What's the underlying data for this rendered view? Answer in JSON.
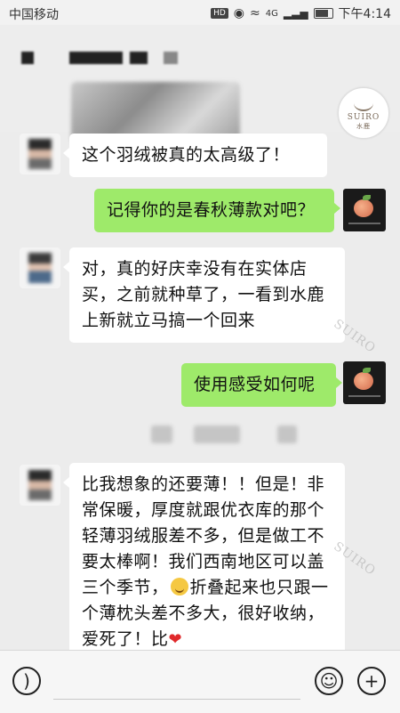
{
  "status_bar": {
    "carrier": "中国移动",
    "hd": "HD",
    "signal": "4G",
    "time": "下午4:14"
  },
  "brand": {
    "name": "SUIRO",
    "subtitle": "水鹿"
  },
  "messages": [
    {
      "side": "left",
      "text": "这个羽绒被真的太高级了！"
    },
    {
      "side": "right",
      "text": "记得你的是春秋薄款对吧？"
    },
    {
      "side": "left",
      "text": "对，真的好庆幸没有在实体店买，之前就种草了，一看到水鹿上新就立马搞一个回来"
    },
    {
      "side": "right",
      "text": "使用感受如何呢"
    },
    {
      "side": "left",
      "text_before": "比我想象的还要薄！！但是！非常保暖，厚度就跟优衣库的那个轻薄羽绒服差不多，但是做工不要太棒啊！我们西南地区可以盖三个季节，",
      "text_after": "折叠起来也只跟一个薄枕头差不多大，很好收纳，爱死了！比"
    }
  ],
  "watermark": "SUIRO",
  "icons": {
    "voice": "voice-icon",
    "emoji": "emoji-icon",
    "plus": "plus-icon"
  },
  "colors": {
    "sent_bubble": "#9eea6a",
    "received_bubble": "#ffffff",
    "background": "#ececec"
  }
}
